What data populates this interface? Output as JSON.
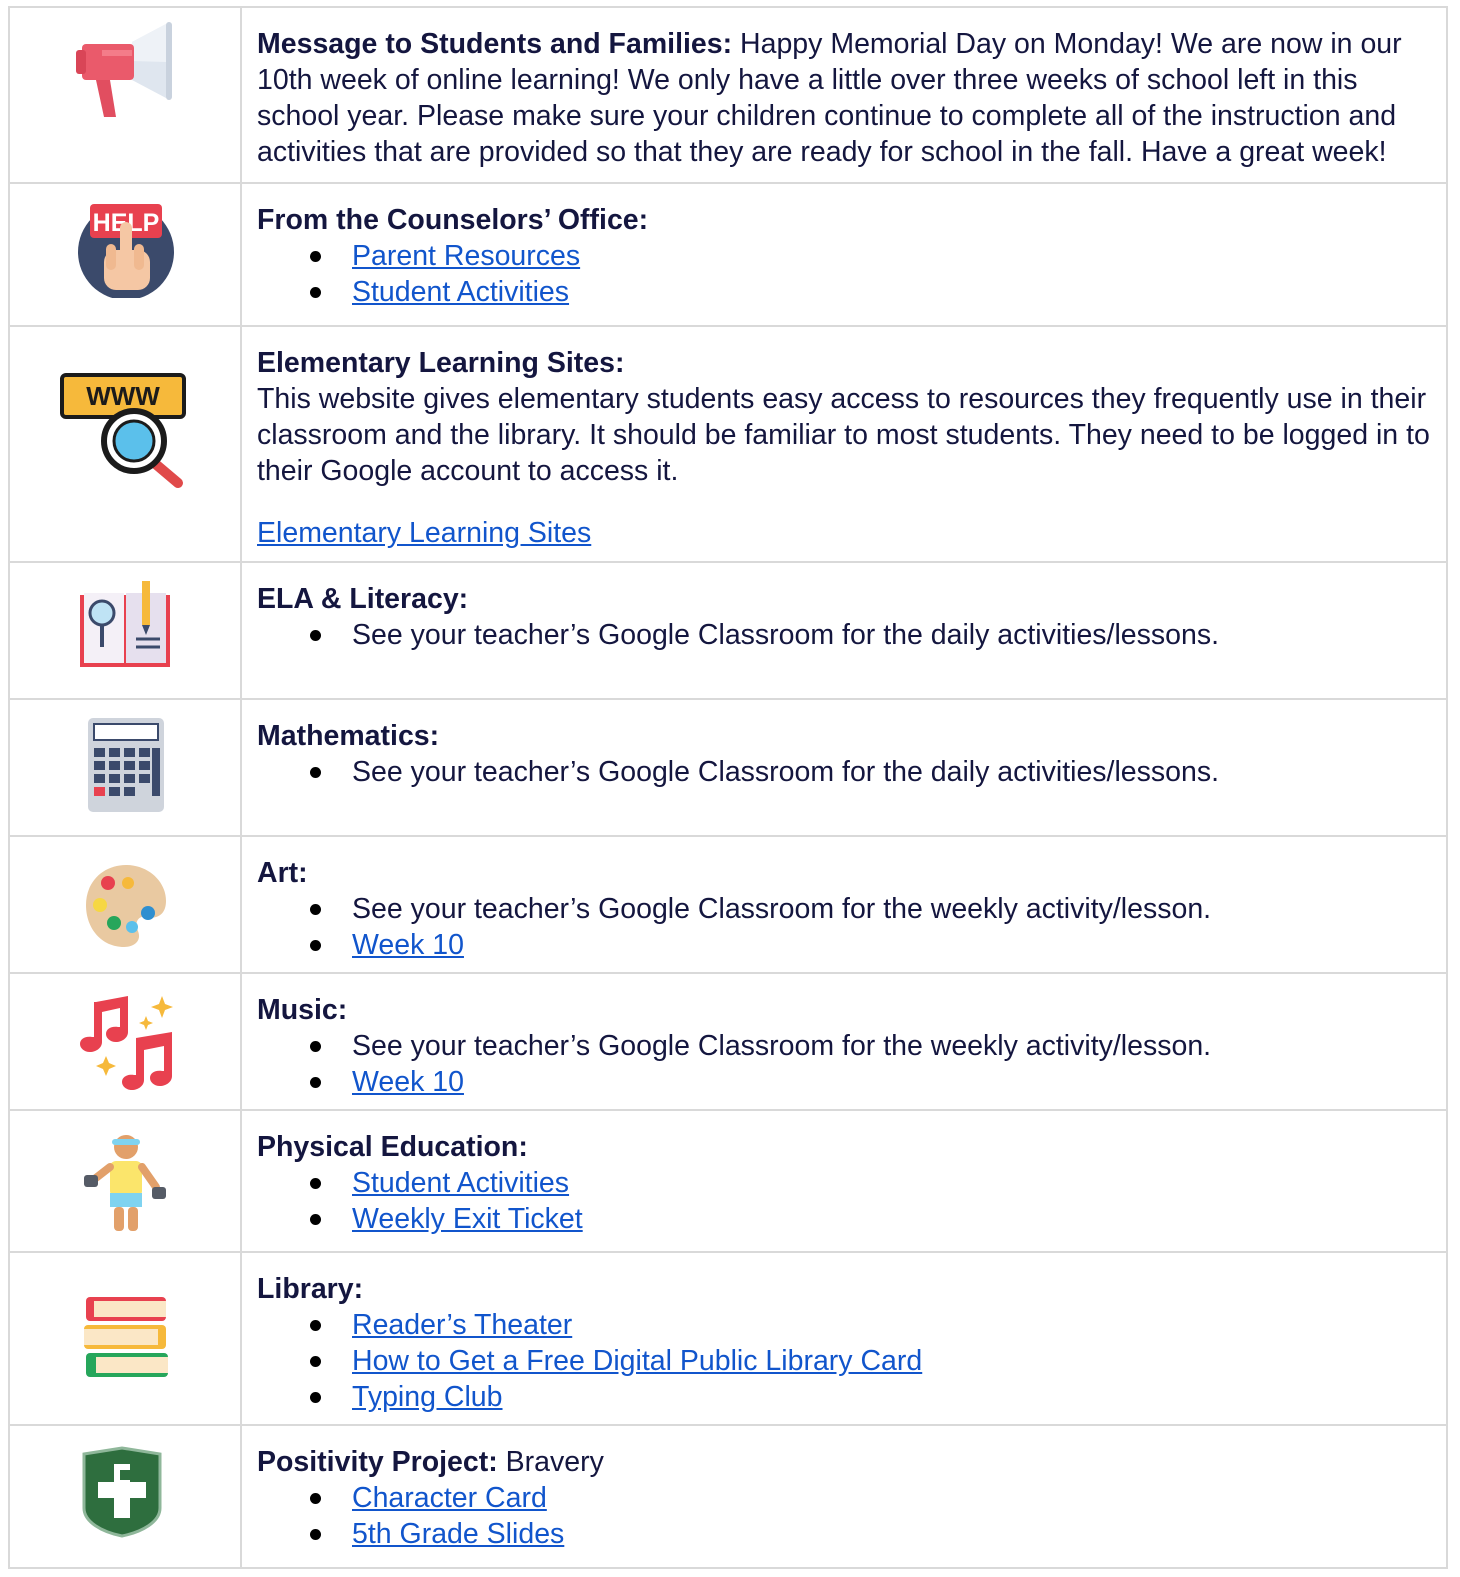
{
  "rows": [
    {
      "heading": "Message to Students and Families:",
      "text": " Happy Memorial Day on Monday! We are now in our 10th week of online learning!  We only have a little over three weeks of school left in this school year. Please make sure your children continue to complete all of the instruction and activities that are provided so that they are ready for school in the fall. Have a great week!"
    },
    {
      "heading": "From the Counselors’ Office:",
      "icon_text": "HELP",
      "links": [
        "Parent Resources",
        "Student Activities"
      ]
    },
    {
      "heading": "Elementary Learning Sites:",
      "icon_text": "WWW",
      "text": "This website gives elementary students easy access to resources they frequently use in their classroom and the library. It should be familiar to most students. They need to be logged in to their Google account to access it.",
      "link": "Elementary Learning Sites"
    },
    {
      "heading": "ELA & Literacy:",
      "items": [
        "See your teacher’s Google Classroom for the daily activities/lessons."
      ]
    },
    {
      "heading": "Mathematics:",
      "items": [
        "See your teacher’s Google Classroom for the daily activities/lessons."
      ]
    },
    {
      "heading": "Art:",
      "items": [
        "See your teacher’s Google Classroom for the weekly activity/lesson."
      ],
      "links": [
        "Week 10"
      ]
    },
    {
      "heading": "Music:",
      "items": [
        "See your teacher’s Google Classroom for the weekly activity/lesson."
      ],
      "links": [
        "Week 10"
      ]
    },
    {
      "heading": "Physical Education:",
      "links": [
        "Student Activities",
        "Weekly Exit Ticket"
      ]
    },
    {
      "heading": "Library:",
      "links": [
        "Reader’s Theater",
        "How to Get a Free Digital Public Library Card",
        "Typing Club"
      ]
    },
    {
      "heading": "Positivity Project:",
      "text": " Bravery",
      "links": [
        "Character Card",
        "5th Grade Slides"
      ]
    }
  ],
  "icons": [
    "megaphone-icon",
    "help-button-icon",
    "www-search-icon",
    "book-magnifier-icon",
    "calculator-icon",
    "paint-palette-icon",
    "music-notes-icon",
    "exercise-person-icon",
    "books-stack-icon",
    "positivity-shield-icon"
  ],
  "colors": {
    "text": "#14163f",
    "link": "#1155cc",
    "border": "#d9d9d9"
  }
}
